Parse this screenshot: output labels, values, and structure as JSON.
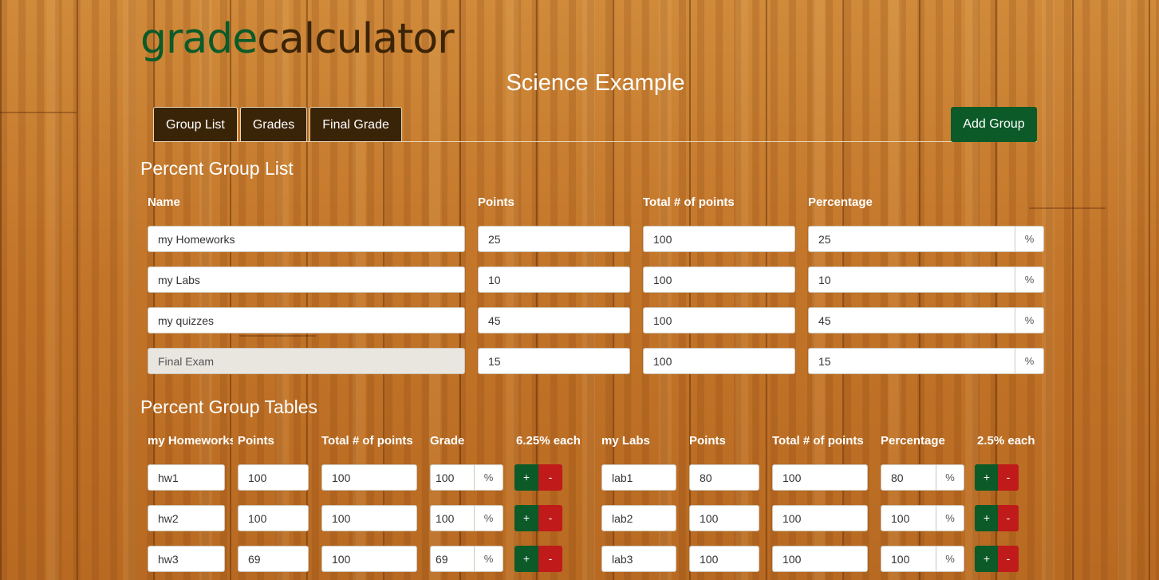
{
  "logo": {
    "part1": "grade",
    "part2": "calculator"
  },
  "page_title": "Science Example",
  "tabs": [
    "Group List",
    "Grades",
    "Final Grade"
  ],
  "add_group_label": "Add Group",
  "group_list": {
    "title": "Percent Group List",
    "headers": {
      "name": "Name",
      "points": "Points",
      "total": "Total # of points",
      "percentage": "Percentage"
    },
    "percent_symbol": "%",
    "rows": [
      {
        "name": "my Homeworks",
        "points": "25",
        "total": "100",
        "percentage": "25"
      },
      {
        "name": "my Labs",
        "points": "10",
        "total": "100",
        "percentage": "10"
      },
      {
        "name": "my quizzes",
        "points": "45",
        "total": "100",
        "percentage": "45"
      },
      {
        "name": "Final Exam",
        "points": "15",
        "total": "100",
        "percentage": "15"
      }
    ]
  },
  "group_tables": {
    "title": "Percent Group Tables",
    "homeworks": {
      "headers": {
        "name": "my Homeworks",
        "points": "Points",
        "total": "Total # of points",
        "grade": "Grade",
        "each": "6.25% each"
      },
      "rows": [
        {
          "name": "hw1",
          "points": "100",
          "total": "100",
          "grade": "100"
        },
        {
          "name": "hw2",
          "points": "100",
          "total": "100",
          "grade": "100"
        },
        {
          "name": "hw3",
          "points": "69",
          "total": "100",
          "grade": "69"
        }
      ]
    },
    "labs": {
      "headers": {
        "name": "my Labs",
        "points": "Points",
        "total": "Total # of points",
        "grade": "Percentage",
        "each": "2.5% each"
      },
      "rows": [
        {
          "name": "lab1",
          "points": "80",
          "total": "100",
          "grade": "80"
        },
        {
          "name": "lab2",
          "points": "100",
          "total": "100",
          "grade": "100"
        },
        {
          "name": "lab3",
          "points": "100",
          "total": "100",
          "grade": "100"
        }
      ]
    },
    "plus_label": "+",
    "minus_label": "-"
  }
}
